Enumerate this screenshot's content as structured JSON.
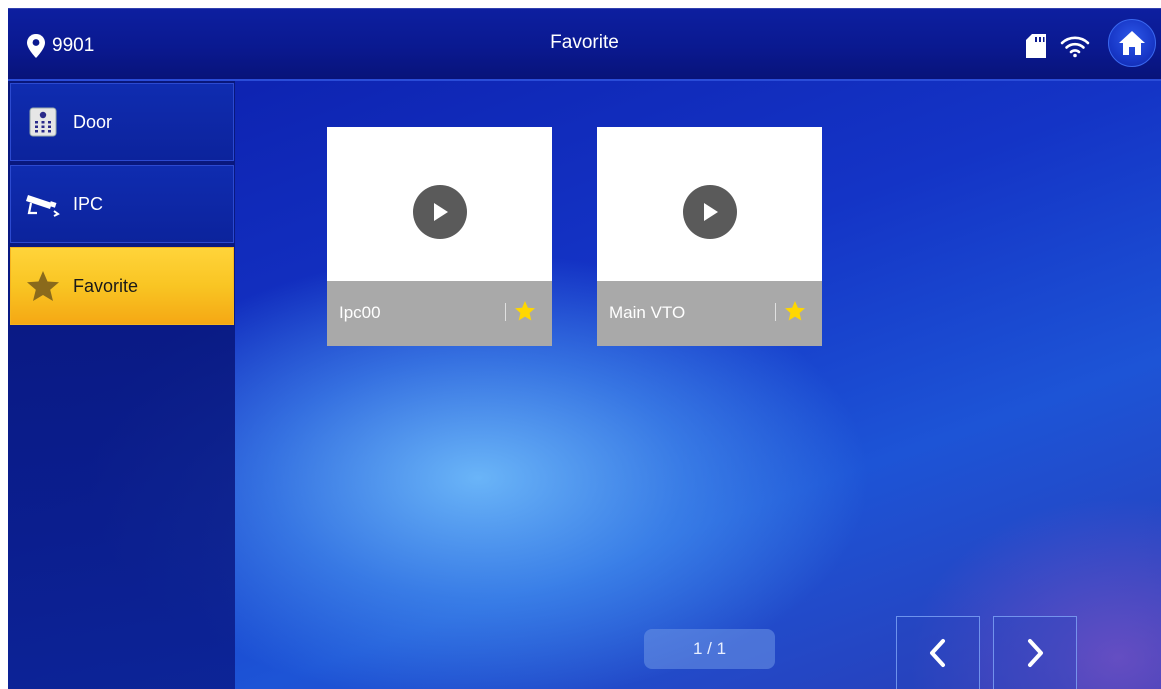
{
  "header": {
    "room_number": "9901",
    "title": "Favorite",
    "icons": [
      "location-pin-icon",
      "sd-card-icon",
      "wifi-icon",
      "home-icon"
    ]
  },
  "sidebar": {
    "items": [
      {
        "label": "Door",
        "icon": "door-keypad-icon",
        "active": false
      },
      {
        "label": "IPC",
        "icon": "camera-icon",
        "active": false
      },
      {
        "label": "Favorite",
        "icon": "star-icon",
        "active": true
      }
    ]
  },
  "favorites": [
    {
      "name": "Ipc00",
      "icon": "play-icon",
      "favorited": true
    },
    {
      "name": "Main VTO",
      "icon": "play-icon",
      "favorited": true
    }
  ],
  "pager": {
    "text": "1 / 1"
  },
  "colors": {
    "accent": "#f9c523",
    "star": "#ffd700",
    "background": "#1434c6"
  }
}
